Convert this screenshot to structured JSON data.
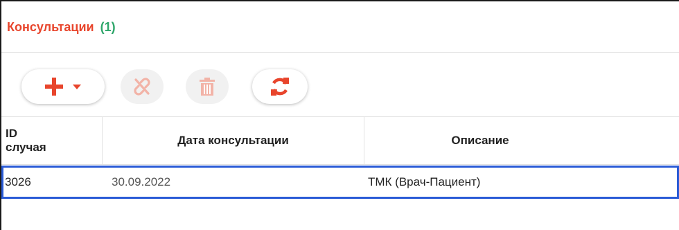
{
  "section": {
    "title": "Консультации",
    "count": "(1)"
  },
  "toolbar": {
    "buttons": [
      {
        "name": "add",
        "icon": "plus-icon",
        "has_dropdown": true,
        "enabled": true,
        "color": "#e8452c"
      },
      {
        "name": "unlink",
        "icon": "unlink-icon",
        "enabled": false,
        "color": "#f2b3a7"
      },
      {
        "name": "delete",
        "icon": "trash-icon",
        "enabled": false,
        "color": "#f2b3a7"
      },
      {
        "name": "refresh",
        "icon": "refresh-icon",
        "enabled": true,
        "color": "#e8452c"
      }
    ]
  },
  "table": {
    "columns": [
      "ID\nслучая",
      "Дата консультации",
      "Описание"
    ],
    "rows": [
      {
        "id": "3026",
        "date": "30.09.2022",
        "description": "ТМК (Врач-Пациент)",
        "selected": true
      }
    ]
  },
  "colors": {
    "accent": "#e8452c",
    "count": "#2ea66a",
    "selection": "#2a5bd6"
  }
}
